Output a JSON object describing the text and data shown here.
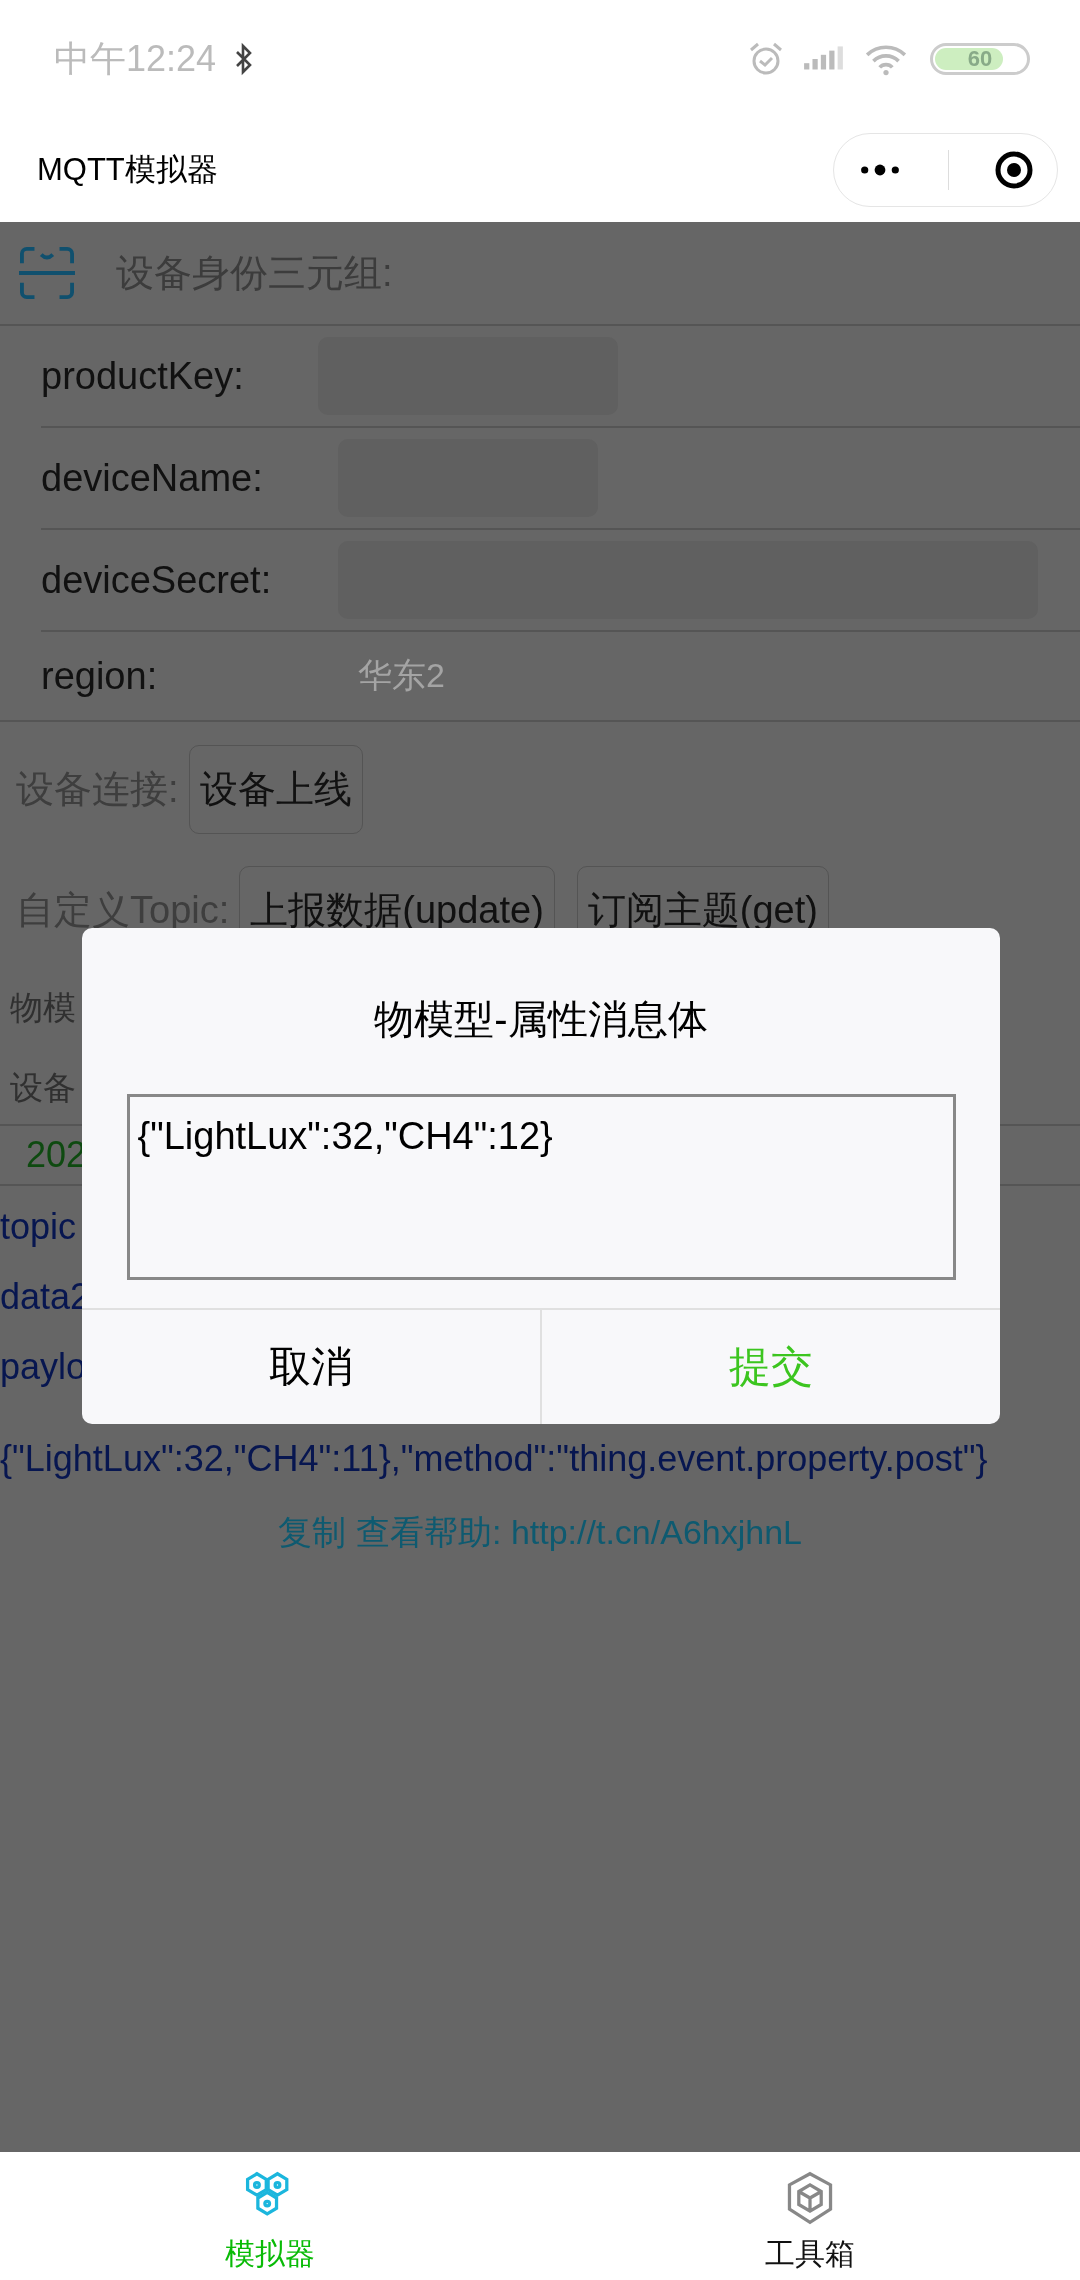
{
  "status_bar": {
    "time": "中午12:24",
    "battery": "60"
  },
  "nav": {
    "title": "MQTT模拟器"
  },
  "identity": {
    "title": "设备身份三元组:",
    "fields": [
      {
        "label": "productKey:",
        "redacted": true
      },
      {
        "label": "deviceName:",
        "redacted": true
      },
      {
        "label": "deviceSecret:",
        "redacted": true
      },
      {
        "label": "region:",
        "redacted": false,
        "value": "华东2"
      }
    ]
  },
  "connect": {
    "label": "设备连接:",
    "buttons": [
      "设备上线"
    ]
  },
  "topic": {
    "label": "自定义Topic:",
    "buttons": [
      "上报数据(update)",
      "订阅主题(get)"
    ]
  },
  "covered_rows": [
    "物模",
    "设备"
  ],
  "log": {
    "timestamp": "202",
    "lines": [
      "topic",
      "data2",
      "paylo"
    ],
    "payload": "{\"LightLux\":32,\"CH4\":11},\"method\":\"thing.event.property.post\"}"
  },
  "help": {
    "copy": "复制",
    "text": "查看帮助: http://t.cn/A6hxjhnL"
  },
  "dialog": {
    "title": "物模型-属性消息体",
    "value": "{\"LightLux\":32,\"CH4\":12}",
    "buttons": [
      {
        "label": "取消",
        "kind": "cancel"
      },
      {
        "label": "提交",
        "kind": "confirm"
      }
    ]
  },
  "tabs": [
    {
      "label": "模拟器",
      "selected": true
    },
    {
      "label": "工具箱",
      "selected": false
    }
  ]
}
